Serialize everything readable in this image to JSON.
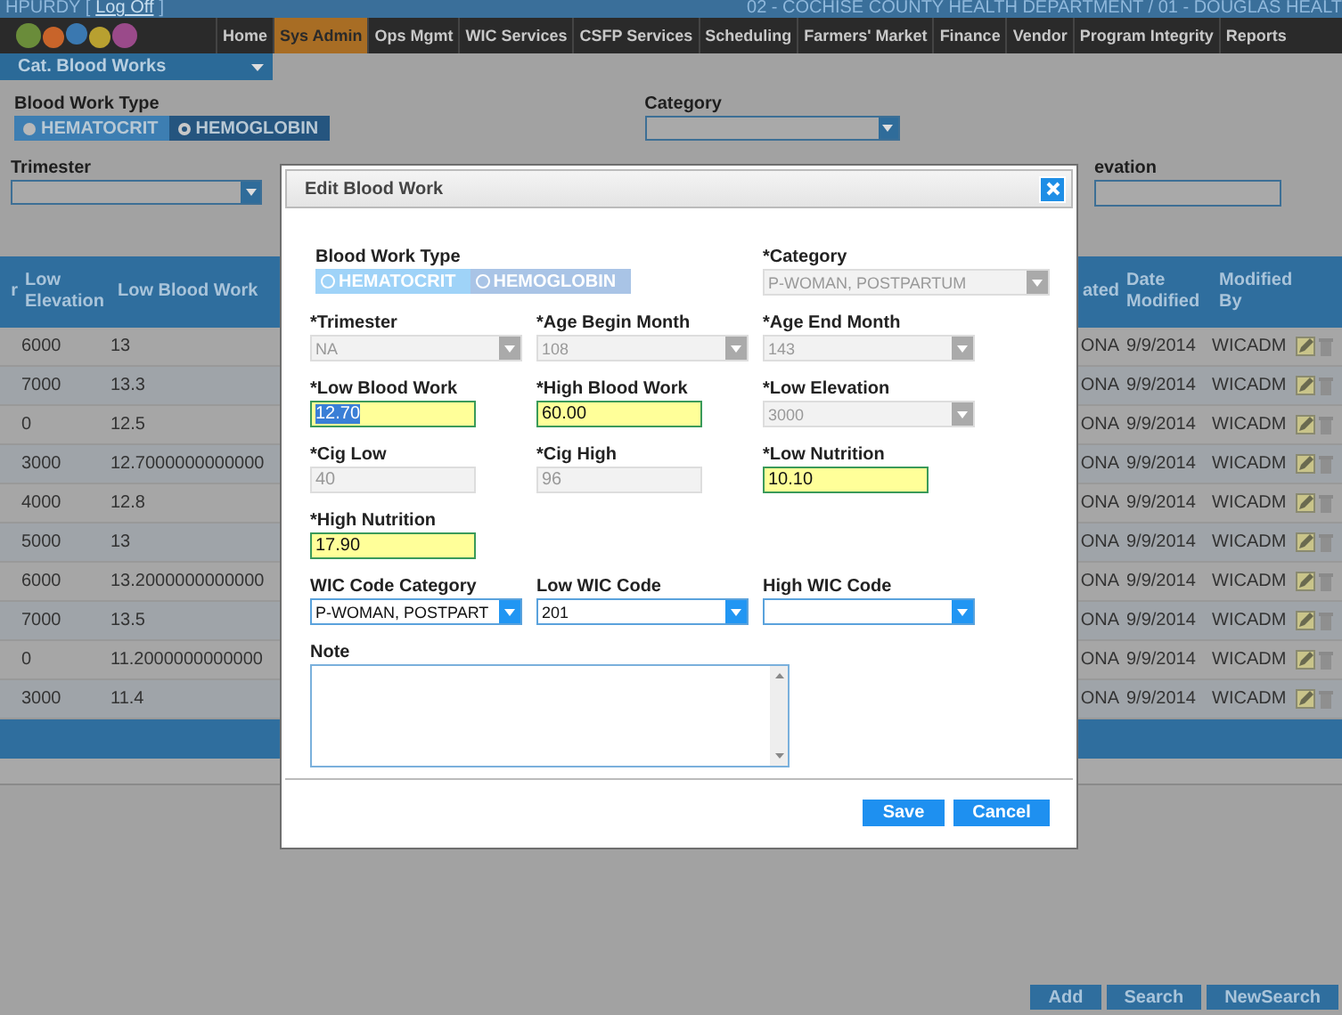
{
  "top_bar": {
    "user": "HPURDY [",
    "logoff": "Log Off",
    "bracket": "]",
    "location": "02 - COCHISE COUNTY HEALTH DEPARTMENT / 01 - DOUGLAS HEALT"
  },
  "nav": [
    {
      "label": "Home",
      "selected": false
    },
    {
      "label": "Sys Admin",
      "selected": true
    },
    {
      "label": "Ops Mgmt",
      "selected": false
    },
    {
      "label": "WIC Services",
      "selected": false
    },
    {
      "label": "CSFP Services",
      "selected": false
    },
    {
      "label": "Scheduling",
      "selected": false
    },
    {
      "label": "Farmers' Market",
      "selected": false
    },
    {
      "label": "Finance",
      "selected": false
    },
    {
      "label": "Vendor",
      "selected": false
    },
    {
      "label": "Program Integrity",
      "selected": false
    },
    {
      "label": "Reports",
      "selected": false
    }
  ],
  "sub_menu": {
    "label": "Cat. Blood Works"
  },
  "filters": {
    "blood_work_type": {
      "label": "Blood Work Type",
      "options": [
        {
          "label": "HEMATOCRIT",
          "selected": false
        },
        {
          "label": "HEMOGLOBIN",
          "selected": true
        }
      ]
    },
    "category": {
      "label": "Category"
    },
    "trimester": {
      "label": "Trimester"
    },
    "elevation": {
      "label": "evation"
    }
  },
  "table": {
    "columns": [
      "r",
      "Low Elevation",
      "Low Blood Work",
      "ated",
      "Date Modified",
      "Modified By"
    ],
    "rows": [
      {
        "cells": [
          "",
          "6000",
          "13",
          "ONA",
          "9/9/2014",
          "WICADM"
        ]
      },
      {
        "cells": [
          "",
          "7000",
          "13.3",
          "ONA",
          "9/9/2014",
          "WICADM"
        ]
      },
      {
        "cells": [
          "",
          "0",
          "12.5",
          "ONA",
          "9/9/2014",
          "WICADM"
        ]
      },
      {
        "cells": [
          "",
          "3000",
          "12.7000000000000",
          "ONA",
          "9/9/2014",
          "WICADM"
        ]
      },
      {
        "cells": [
          "",
          "4000",
          "12.8",
          "ONA",
          "9/9/2014",
          "WICADM"
        ]
      },
      {
        "cells": [
          "",
          "5000",
          "13",
          "ONA",
          "9/9/2014",
          "WICADM"
        ]
      },
      {
        "cells": [
          "",
          "6000",
          "13.2000000000000",
          "ONA",
          "9/9/2014",
          "WICADM"
        ]
      },
      {
        "cells": [
          "",
          "7000",
          "13.5",
          "ONA",
          "9/9/2014",
          "WICADM"
        ]
      },
      {
        "cells": [
          "",
          "0",
          "11.2000000000000",
          "ONA",
          "9/9/2014",
          "WICADM"
        ]
      },
      {
        "cells": [
          "",
          "3000",
          "11.4",
          "ONA",
          "9/9/2014",
          "WICADM"
        ]
      }
    ]
  },
  "bottom_buttons": [
    "Add",
    "Search",
    "NewSearch"
  ],
  "modal": {
    "title": "Edit Blood Work",
    "header_row": [
      {
        "kind": "toggle",
        "label": "Blood Work Type",
        "disabled": true,
        "options": [
          {
            "label": "HEMATOCRIT",
            "selected": true
          },
          {
            "label": "HEMOGLOBIN",
            "selected": false
          }
        ]
      },
      {
        "kind": "select",
        "label": "*Category",
        "value": "P-WOMAN, POSTPARTUM",
        "disabled": true
      }
    ],
    "rows": [
      [
        {
          "kind": "select",
          "label": "*Trimester",
          "value": "NA",
          "disabled": true
        },
        {
          "kind": "select",
          "label": "*Age Begin Month",
          "value": "108",
          "disabled": true
        },
        {
          "kind": "select",
          "label": "*Age End Month",
          "value": "143",
          "disabled": true
        }
      ],
      [
        {
          "kind": "input",
          "label": "*Low Blood Work",
          "value": "12.70",
          "disabled": false,
          "highlighted": true,
          "text_selected": true
        },
        {
          "kind": "input",
          "label": "*High Blood Work",
          "value": "60.00",
          "disabled": false,
          "highlighted": true,
          "text_selected": false
        },
        {
          "kind": "select",
          "label": "*Low Elevation",
          "value": "3000",
          "disabled": true
        }
      ],
      [
        {
          "kind": "input",
          "label": "*Cig Low",
          "value": "40",
          "disabled": true,
          "highlighted": false,
          "text_selected": false
        },
        {
          "kind": "input",
          "label": "*Cig High",
          "value": "96",
          "disabled": true,
          "highlighted": false,
          "text_selected": false
        },
        {
          "kind": "input",
          "label": "*Low Nutrition",
          "value": "10.10",
          "disabled": false,
          "highlighted": true,
          "text_selected": false
        }
      ],
      [
        {
          "kind": "input",
          "label": "*High Nutrition",
          "value": "17.90",
          "disabled": false,
          "highlighted": true,
          "text_selected": false
        }
      ],
      [
        {
          "kind": "select",
          "label": "WIC Code Category",
          "value": "P-WOMAN, POSTPART",
          "disabled": false
        },
        {
          "kind": "select",
          "label": "Low WIC Code",
          "value": "201",
          "disabled": false
        },
        {
          "kind": "select",
          "label": "High WIC Code",
          "disabled": false
        }
      ],
      [
        {
          "kind": "textarea",
          "label": "Note",
          "disabled": false
        }
      ]
    ],
    "buttons": [
      "Save",
      "Cancel"
    ]
  }
}
